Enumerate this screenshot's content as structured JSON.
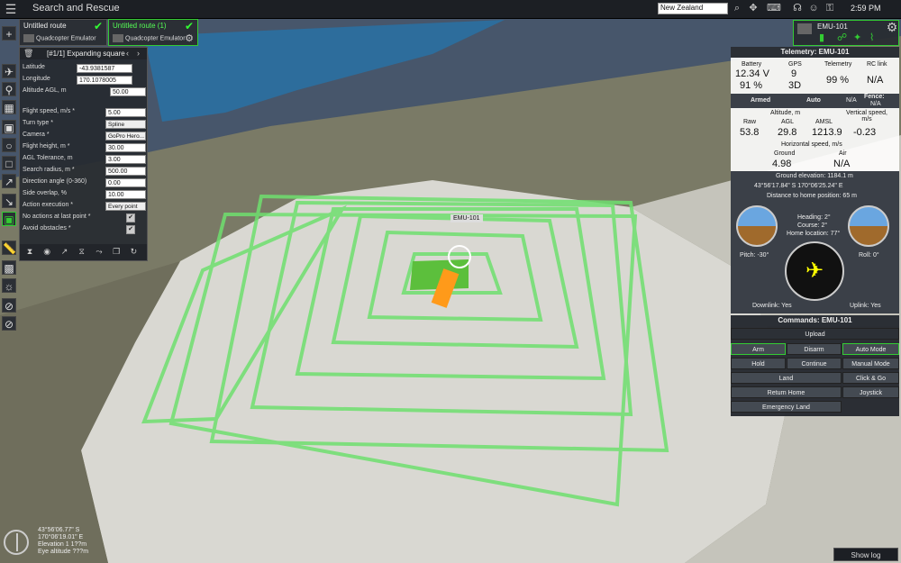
{
  "app": {
    "title": "Search and Rescue"
  },
  "topbar": {
    "search_value": "New Zealand",
    "time": "2:59 PM"
  },
  "routes": [
    {
      "name": "Untitled route",
      "device": "Quadcopter Emulator"
    },
    {
      "name": "Untitled route (1)",
      "device": "Quadcopter Emulator"
    }
  ],
  "mission_panel": {
    "header": "[#1/1] Expanding square",
    "latitude_label": "Latitude",
    "latitude_value": "-43.9381587",
    "longitude_label": "Longitude",
    "longitude_value": "170.1078005",
    "altitude_label": "Altitude AGL, m",
    "altitude_value": "50.00",
    "flight_speed_label": "Flight speed, m/s *",
    "flight_speed_value": "5.00",
    "turn_type_label": "Turn type *",
    "turn_type_value": "Spline",
    "camera_label": "Camera *",
    "camera_value": "GoPro Hero...",
    "flight_height_label": "Flight height, m *",
    "flight_height_value": "30.00",
    "agl_tol_label": "AGL Tolerance, m",
    "agl_tol_value": "3.00",
    "search_radius_label": "Search radius, m *",
    "search_radius_value": "500.00",
    "direction_label": "Direction angle (0-360)",
    "direction_value": "0.00",
    "side_overlap_label": "Side overlap, %",
    "side_overlap_value": "10.00",
    "action_exec_label": "Action execution *",
    "action_exec_value": "Every point",
    "no_actions_label": "No actions at last point *",
    "avoid_label": "Avoid obstacles *"
  },
  "vehicle": {
    "name": "EMU-101",
    "map_label": "EMU-101"
  },
  "telemetry": {
    "header": "Telemetry: EMU-101",
    "battery_label": "Battery",
    "battery_v": "12.34 V",
    "battery_pct": "91 %",
    "gps_label": "GPS",
    "gps_sats": "9",
    "gps_fix": "3D",
    "telemetry_label": "Telemetry",
    "telemetry_value": "99 %",
    "rc_label": "RC link",
    "rc_value": "N/A",
    "armed": "Armed",
    "mode": "Auto",
    "mode_extra": "N/A",
    "fence_label": "Fence:",
    "fence_value": "N/A",
    "altitude_label": "Altitude, m",
    "raw_label": "Raw",
    "raw_value": "53.8",
    "agl_label": "AGL",
    "agl_value": "29.8",
    "amsl_label": "AMSL",
    "amsl_value": "1213.9",
    "vspeed_label": "Vertical speed, m/s",
    "vspeed_value": "-0.23",
    "hspeed_label": "Horizontal speed, m/s",
    "ground_label": "Ground",
    "ground_value": "4.98",
    "air_label": "Air",
    "air_value": "N/A",
    "ground_elevation": "Ground elevation: 1184.1 m",
    "position": "43°56'17.84\" S  170°06'25.24\" E",
    "home_distance": "Distance to home position: 65 m",
    "heading": "Heading: 2°",
    "course": "Course: 2°",
    "home_location": "Home location: 77°",
    "pitch": "Pitch: -30°",
    "roll": "Roll: 0°",
    "downlink": "Downlink: Yes",
    "uplink": "Uplink: Yes"
  },
  "commands": {
    "header": "Commands: EMU-101",
    "upload": "Upload",
    "arm": "Arm",
    "disarm": "Disarm",
    "auto_mode": "Auto Mode",
    "hold": "Hold",
    "continue": "Continue",
    "manual_mode": "Manual Mode",
    "land": "Land",
    "click_go": "Click & Go",
    "return_home": "Return Home",
    "joystick": "Joystick",
    "emergency_land": "Emergency Land"
  },
  "footer": {
    "coord_lat": "43°56'06.77\" S",
    "coord_lon": "170°06'19.01\" E",
    "elevation": "Elevation 1 1??m",
    "eye_altitude": "Eye altitude ???m",
    "show_log": "Show log"
  },
  "colors": {
    "accent_green": "#33cc33",
    "panel_bg": "#262a30",
    "lake": "#2d6d9c"
  }
}
